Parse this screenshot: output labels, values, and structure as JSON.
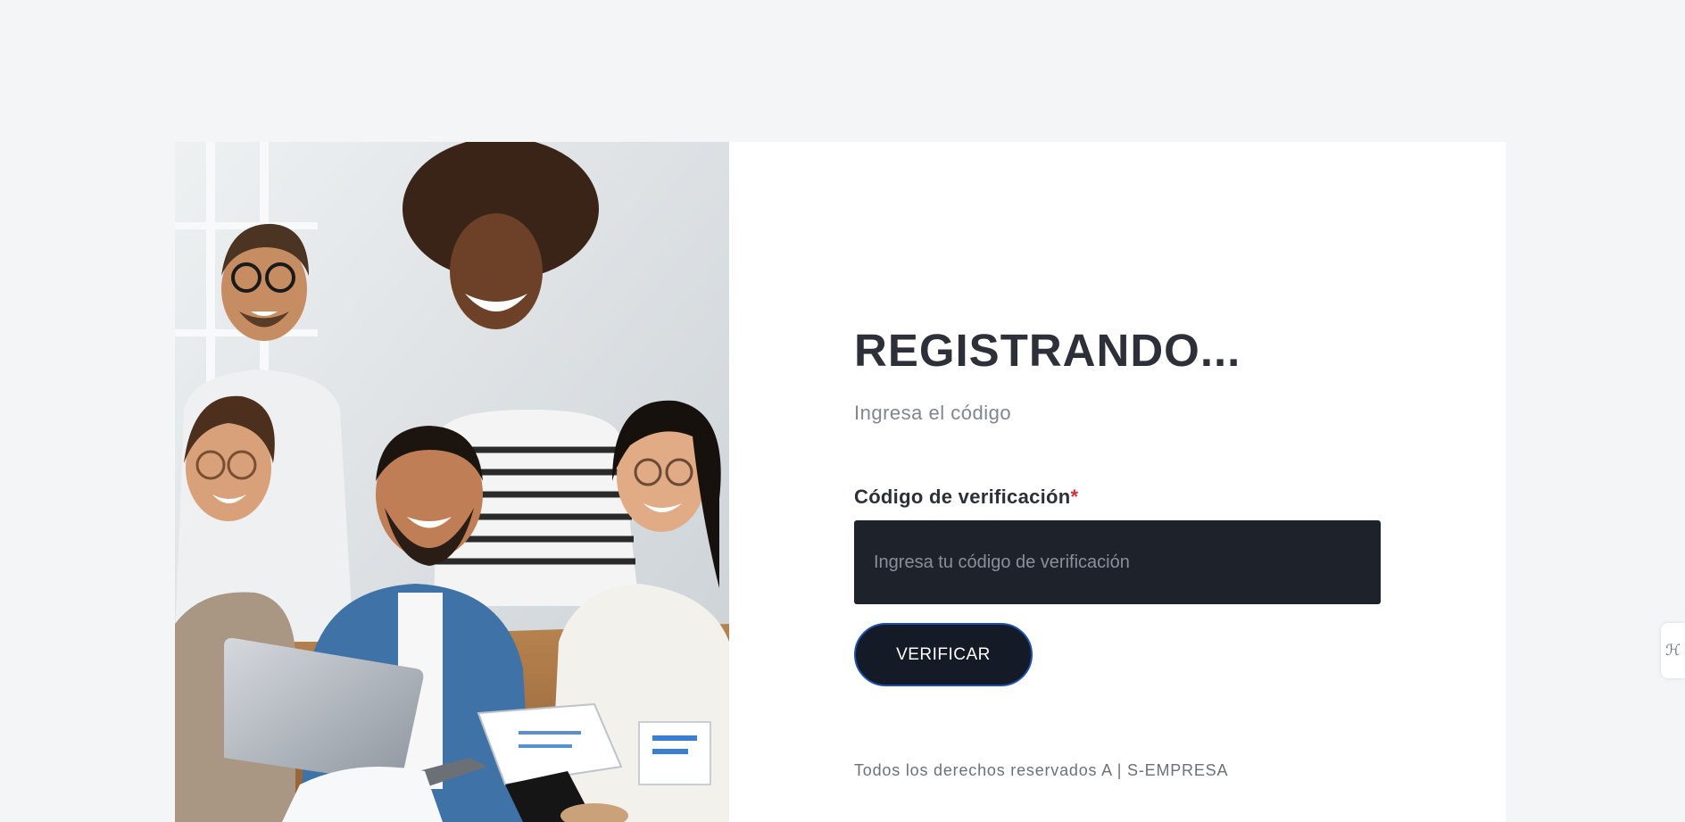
{
  "hero": {
    "image_alt": "Group of smiling people working together at a laptop"
  },
  "form": {
    "title": "REGISTRANDO...",
    "subtitle": "Ingresa el código",
    "code_label": "Código de verificación",
    "required_marker": "*",
    "code_value": "",
    "code_placeholder": "Ingresa tu código de verificación",
    "verify_label": "VERIFICAR"
  },
  "footer": {
    "text": "Todos los derechos reservados A | S-EMPRESA"
  },
  "side_tab": {
    "icon": "translate-icon",
    "glyph": "ℋ"
  },
  "colors": {
    "page_background": "#f4f5f7",
    "card_background": "#ffffff",
    "title": "#2d3038",
    "subtitle": "#80858e",
    "required": "#d62b3a",
    "input_background": "#1e222b",
    "button_background": "#141a26",
    "button_border": "#1e4fa8",
    "footer_text": "#6b717b"
  }
}
